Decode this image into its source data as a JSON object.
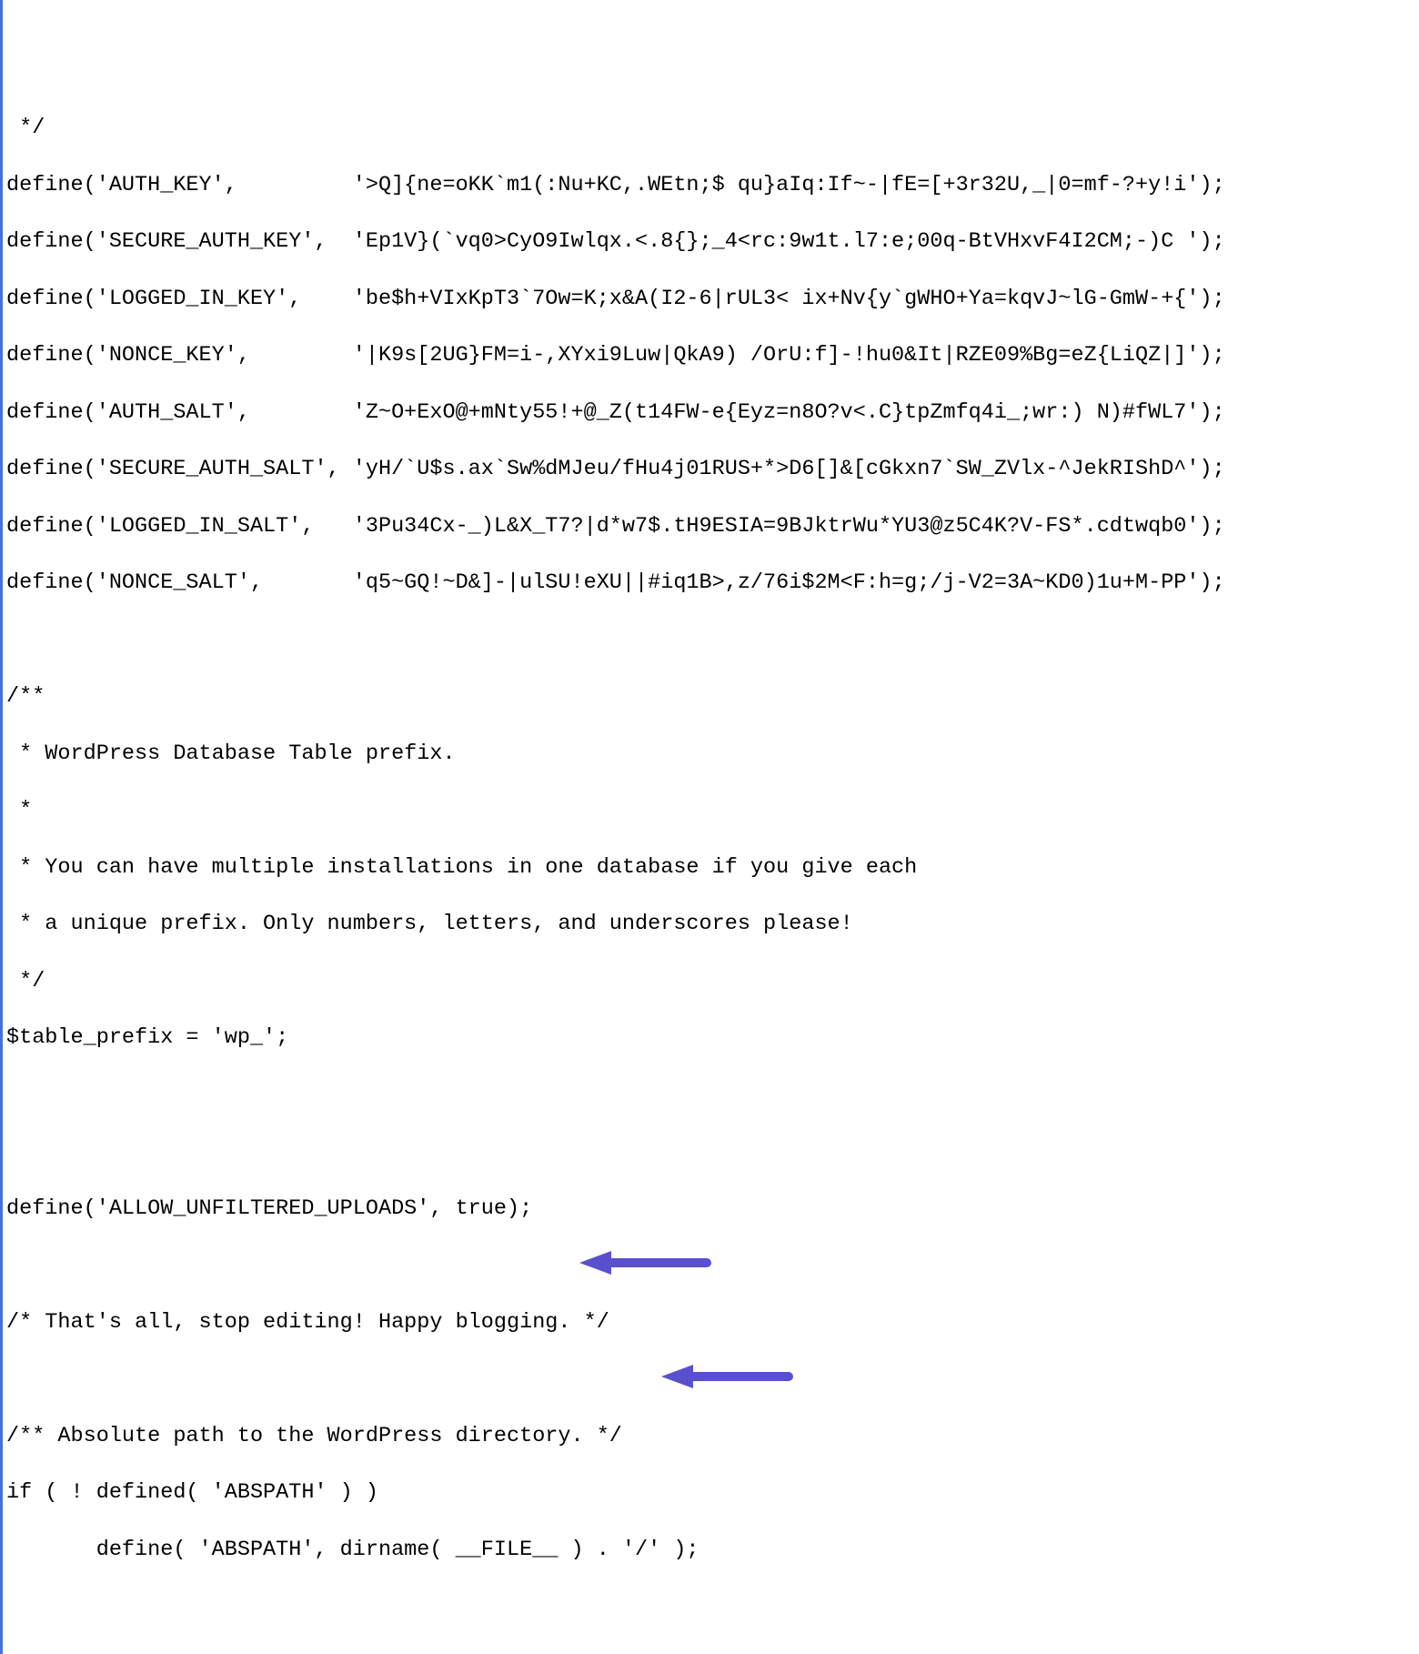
{
  "code": {
    "line_close_comment": " */",
    "define_auth_key": "define('AUTH_KEY',         '>Q]{ne=oKK`m1(:Nu+KC,.WEtn;$ qu}aIq:If~-|fE=[+3r32U,_|0=mf-?+y!i');",
    "define_secure_auth_key": "define('SECURE_AUTH_KEY',  'Ep1V}(`vq0>CyO9Iwlqx.<.8{};_4<rc:9w1t.l7:e;00q-BtVHxvF4I2CM;-)C ');",
    "define_logged_in_key": "define('LOGGED_IN_KEY',    'be$h+VIxKpT3`7Ow=K;x&A(I2-6|rUL3< ix+Nv{y`gWHO+Ya=kqvJ~lG-GmW-+{');",
    "define_nonce_key": "define('NONCE_KEY',        '|K9s[2UG}FM=i-,XYxi9Luw|QkA9) /OrU:f]-!hu0&It|RZE09%Bg=eZ{LiQZ|]');",
    "define_auth_salt": "define('AUTH_SALT',        'Z~O+ExO@+mNty55!+@_Z(t14FW-e{Eyz=n8O?v<.C}tpZmfq4i_;wr:) N)#fWL7');",
    "define_secure_auth_salt": "define('SECURE_AUTH_SALT', 'yH/`U$s.ax`Sw%dMJeu/fHu4j01RUS+*>D6[]&[cGkxn7`SW_ZVlx-^JekRIShD^');",
    "define_logged_in_salt": "define('LOGGED_IN_SALT',   '3Pu34Cx-_)L&X_T7?|d*w7$.tH9ESIA=9BJktrWu*YU3@z5C4K?V-FS*.cdtwqb0');",
    "define_nonce_salt": "define('NONCE_SALT',       'q5~GQ!~D&]-|ulSU!eXU||#iq1B>,z/76i$2M<F:h=g;/j-V2=3A~KD0)1u+M-PP');",
    "comment_open": "/**",
    "comment_line1": " * WordPress Database Table prefix.",
    "comment_line2": " *",
    "comment_line3": " * You can have multiple installations in one database if you give each",
    "comment_line4": " * a unique prefix. Only numbers, letters, and underscores please!",
    "comment_close": " */",
    "table_prefix": "$table_prefix = 'wp_';",
    "define_allow_unfiltered": "define('ALLOW_UNFILTERED_UPLOADS', true);",
    "stop_editing": "/* That's all, stop editing! Happy blogging. */",
    "abspath_comment": "/** Absolute path to the WordPress directory. */",
    "if_not_defined": "if ( ! defined( 'ABSPATH' ) )",
    "define_abspath": "       define( 'ABSPATH', dirname( __FILE__ ) . '/' );"
  },
  "arrow_color": "#5a4fcf"
}
